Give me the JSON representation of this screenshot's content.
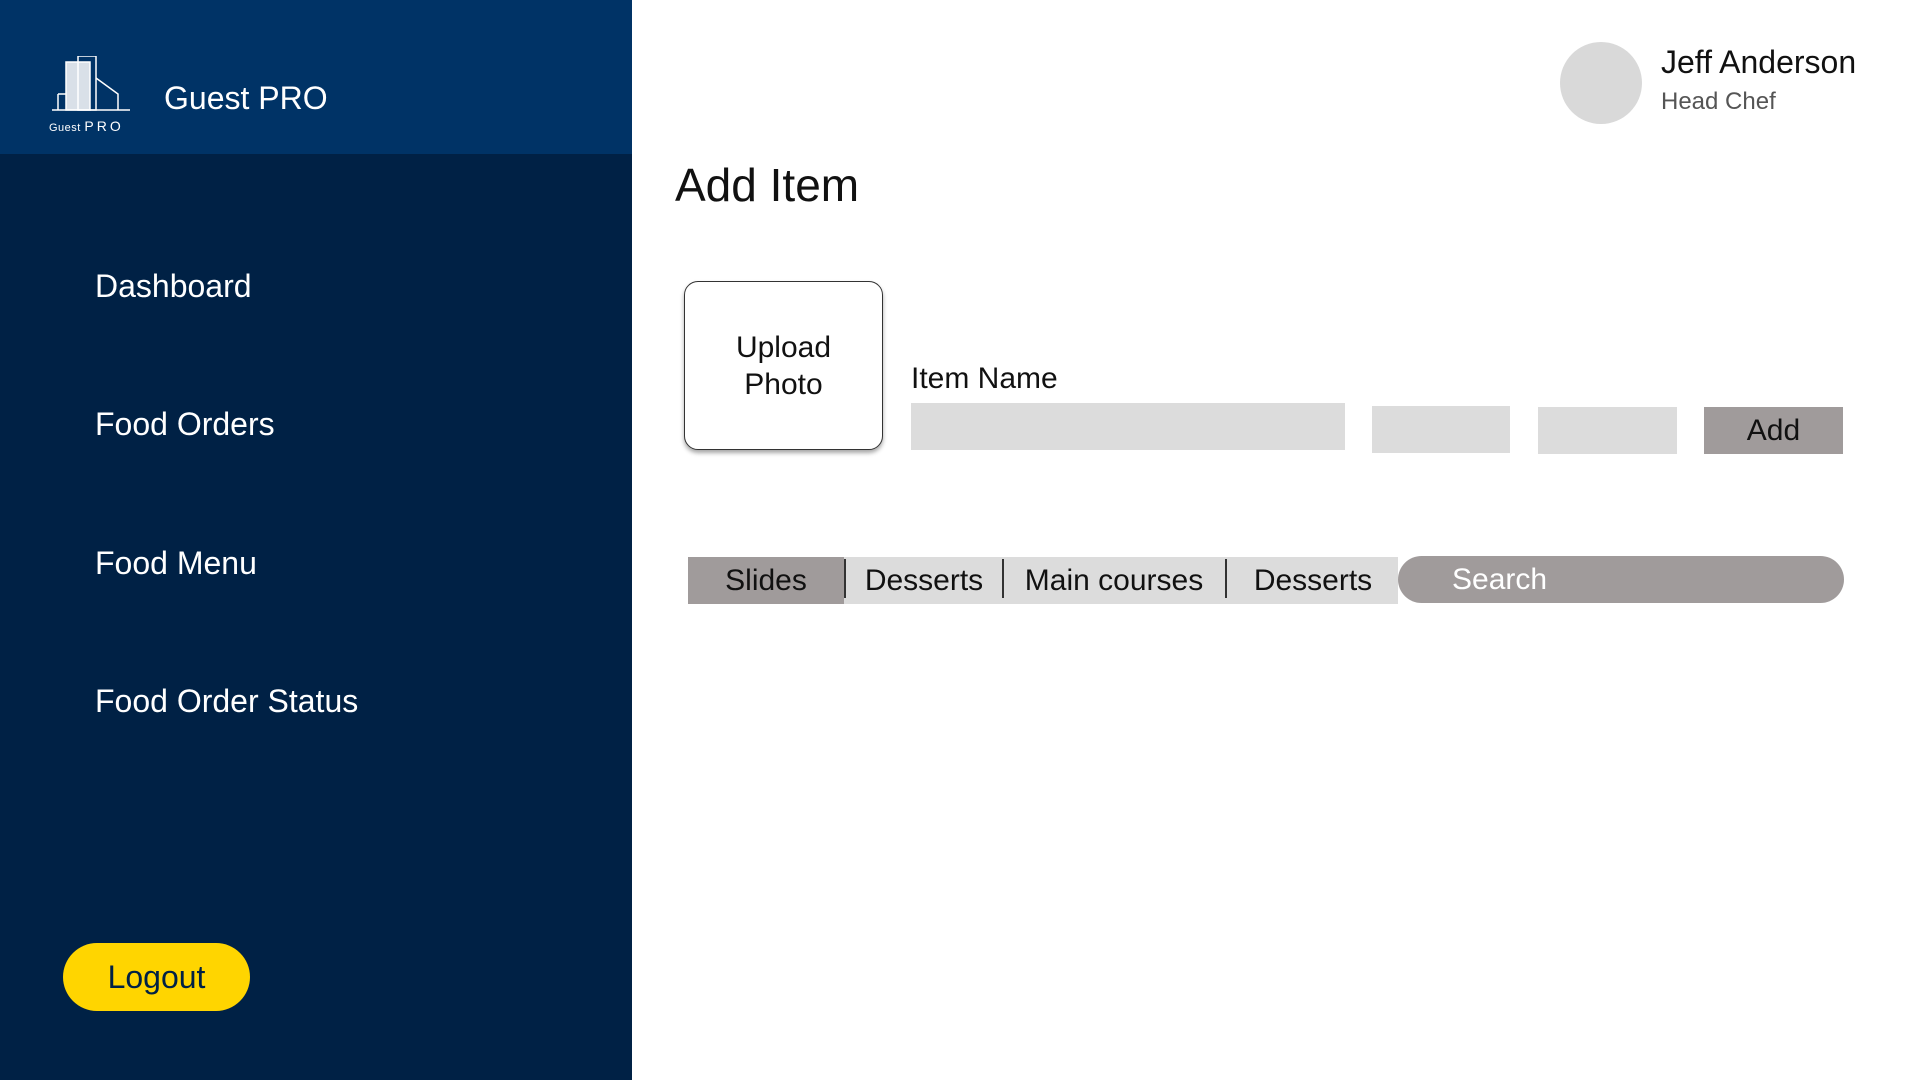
{
  "brand": {
    "logo_text_small": "Guest",
    "logo_text_big": "PRO",
    "app_title": "Guest PRO"
  },
  "sidebar": {
    "items": [
      {
        "label": "Dashboard"
      },
      {
        "label": "Food Orders"
      },
      {
        "label": "Food Menu"
      },
      {
        "label": "Food Order Status"
      }
    ],
    "logout_label": "Logout"
  },
  "user": {
    "name": "Jeff Anderson",
    "role": "Head Chef"
  },
  "main": {
    "title": "Add Item",
    "upload_label": "Upload\nPhoto",
    "item_name_label": "Item Name",
    "item_name_value": "",
    "field_2_value": "",
    "field_3_value": "",
    "add_label": "Add",
    "tabs": [
      {
        "label": "Slides"
      },
      {
        "label": "Desserts"
      },
      {
        "label": "Main courses"
      },
      {
        "label": "Desserts"
      }
    ],
    "active_tab": "Slides",
    "search_placeholder": "Search"
  },
  "colors": {
    "sidebar": "#002145",
    "brand_bar": "#003366",
    "logout": "#ffd500",
    "button_gray": "#a09b9b",
    "field_gray": "#dcdcdc"
  }
}
